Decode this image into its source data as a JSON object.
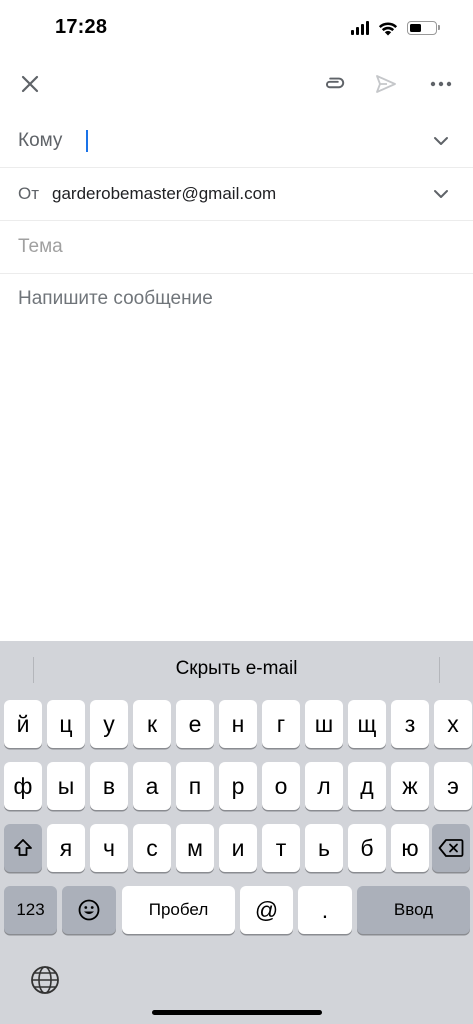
{
  "status": {
    "time": "17:28"
  },
  "compose": {
    "to_label": "Кому",
    "from_label": "От",
    "from_value": "garderobemaster@gmail.com",
    "subject_placeholder": "Тема",
    "body_placeholder": "Напишите сообщение"
  },
  "keyboard": {
    "suggestion": "Скрыть e-mail",
    "row1": [
      "й",
      "ц",
      "у",
      "к",
      "е",
      "н",
      "г",
      "ш",
      "щ",
      "з",
      "х"
    ],
    "row2": [
      "ф",
      "ы",
      "в",
      "а",
      "п",
      "р",
      "о",
      "л",
      "д",
      "ж",
      "э"
    ],
    "row3": [
      "я",
      "ч",
      "с",
      "м",
      "и",
      "т",
      "ь",
      "б",
      "ю"
    ],
    "numbers_label": "123",
    "space_label": "Пробел",
    "at_label": "@",
    "dot_label": ".",
    "return_label": "Ввод"
  },
  "colors": {
    "accent": "#1a73e8",
    "keyboard_bg": "#d2d4d9"
  }
}
